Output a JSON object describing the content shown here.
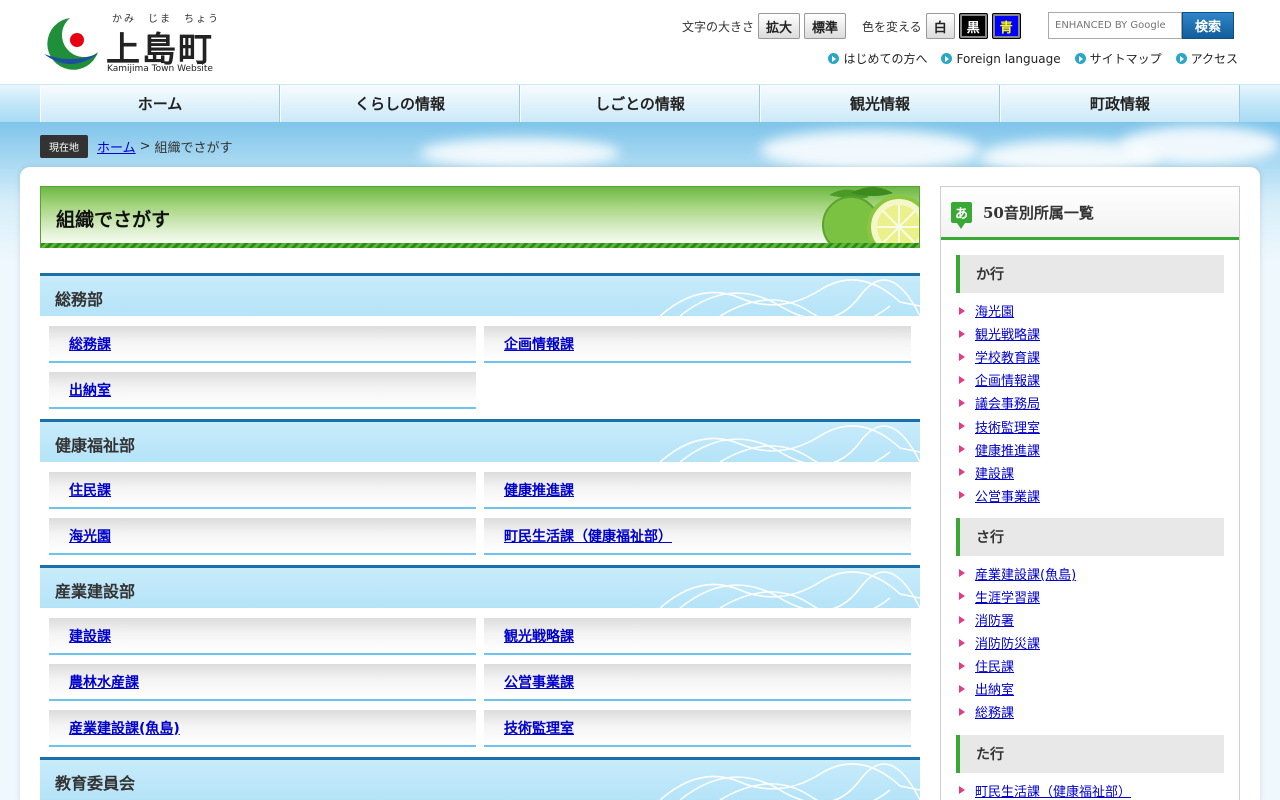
{
  "header": {
    "logo_ruby": "かみ　じま　ちょう",
    "logo_title": "上島町",
    "logo_sub": "Kamijima Town Website",
    "font_size_label": "文字の大きさ",
    "font_size_buttons": [
      "拡大",
      "標準"
    ],
    "color_label": "色を変える",
    "color_buttons": [
      "白",
      "黒",
      "青"
    ],
    "search_placeholder": "ENHANCED BY Google",
    "search_button": "検索",
    "sublinks": [
      "はじめての方へ",
      "Foreign language",
      "サイトマップ",
      "アクセス"
    ]
  },
  "nav": [
    "ホーム",
    "くらしの情報",
    "しごとの情報",
    "観光情報",
    "町政情報"
  ],
  "breadcrumb": {
    "badge": "現在地",
    "home": "ホーム",
    "separator": ">",
    "current": "組織でさがす"
  },
  "main": {
    "title": "組織でさがす",
    "departments": [
      {
        "name": "総務部",
        "sections": [
          "総務課",
          "企画情報課",
          "出納室"
        ]
      },
      {
        "name": "健康福祉部",
        "sections": [
          "住民課",
          "健康推進課",
          "海光園",
          "町民生活課（健康福祉部）"
        ]
      },
      {
        "name": "産業建設部",
        "sections": [
          "建設課",
          "観光戦略課",
          "農林水産課",
          "公営事業課",
          "産業建設課(魚島)",
          "技術監理室"
        ]
      },
      {
        "name": "教育委員会",
        "sections": []
      }
    ]
  },
  "side": {
    "icon_char": "あ",
    "title": "50音別所属一覧",
    "groups": [
      {
        "name": "か行",
        "items": [
          "海光園",
          "観光戦略課",
          "学校教育課",
          "企画情報課",
          "議会事務局",
          "技術監理室",
          "健康推進課",
          "建設課",
          "公営事業課"
        ]
      },
      {
        "name": "さ行",
        "items": [
          "産業建設課(魚島)",
          "生涯学習課",
          "消防署",
          "消防防災課",
          "住民課",
          "出納室",
          "総務課"
        ]
      },
      {
        "name": "た行",
        "items": [
          "町民生活課（健康福祉部）"
        ]
      }
    ]
  },
  "colors": {
    "nav_bg": "#c3e6f8",
    "title_green": "#5aa232",
    "dept_border": "#1a70a8",
    "accent_green": "#39a935",
    "bullet_pink": "#e83a83",
    "link": "#0000cc"
  }
}
